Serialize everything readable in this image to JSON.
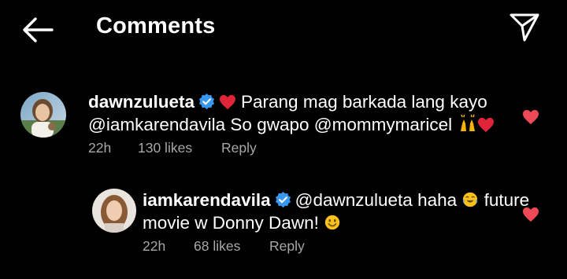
{
  "header": {
    "title": "Comments"
  },
  "comments": [
    {
      "username": "dawnzulueta",
      "line1": "Parang mag barkada lang kayo",
      "line2": "@iamkarendavila So gwapo @mommymaricel",
      "time": "22h",
      "likes": "130 likes",
      "reply": "Reply",
      "liked": true
    },
    {
      "username": "iamkarendavila",
      "line1_mention": "@dawnzulueta",
      "line1_text": "haha",
      "line1_after": "future",
      "line2": "movie w Donny Dawn!",
      "time": "22h",
      "likes": "68 likes",
      "reply": "Reply",
      "liked": true
    }
  ],
  "colors": {
    "background": "#000000",
    "text": "#ffffff",
    "meta": "#a8a8a8",
    "verified": "#3897f0",
    "heart": "#ed4956"
  }
}
